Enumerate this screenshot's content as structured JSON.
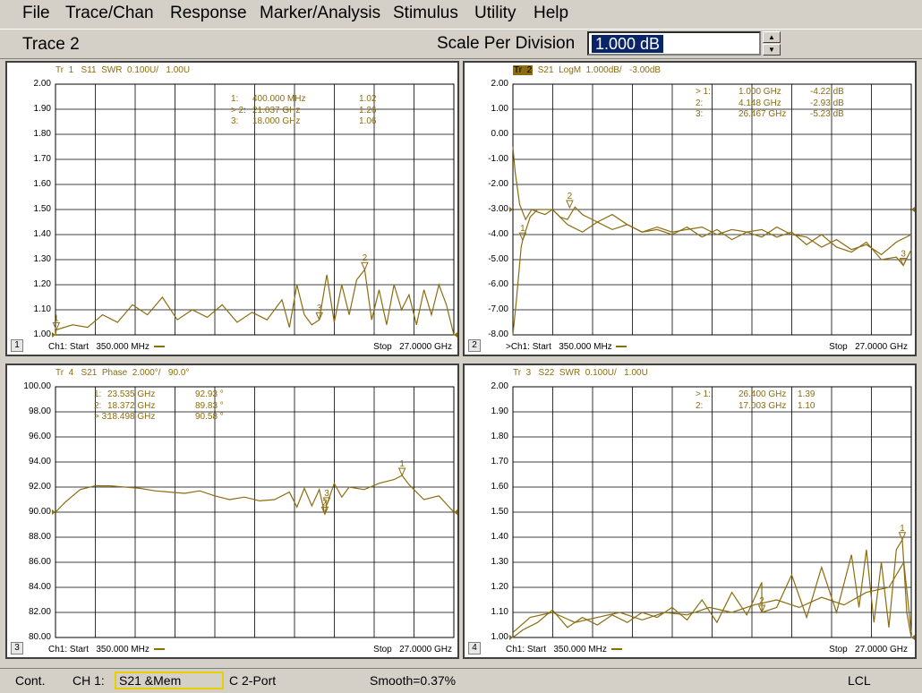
{
  "menu": [
    "File",
    "Trace/Chan",
    "Response",
    "Marker/Analysis",
    "Stimulus",
    "Utility",
    "Help"
  ],
  "toolbar": {
    "active_trace": "Trace 2",
    "scale_label": "Scale Per Division",
    "scale_value": "1.000 dB",
    "spin_up": "▲",
    "spin_down": "▼"
  },
  "colors": {
    "trace": "#8b6c0f",
    "grid": "#000000",
    "bg": "#d4d0c8"
  },
  "panels": [
    {
      "number": "1",
      "trace_info": "Tr  1   S11  SWR  0.100U/   1.00U",
      "start": "Ch1: Start   350.000 MHz ",
      "stop": "Stop   27.0000 GHz",
      "markers": [
        {
          "label": "1:",
          "freq": "400.000 MHz",
          "value": "1.02"
        },
        {
          "label": "> 2:",
          "freq": "21.037 GHz",
          "value": "1.26"
        },
        {
          "label": "3:",
          "freq": "18.000 GHz",
          "value": "1.06"
        }
      ]
    },
    {
      "number": "2",
      "trace_info_hl": "Tr  2",
      "trace_info": "  S21  LogM  1.000dB/   -3.00dB",
      "start": ">Ch1: Start   350.000 MHz ",
      "stop": "Stop   27.0000 GHz",
      "markers": [
        {
          "label": "> 1:",
          "freq": "1.000 GHz",
          "value": "-4.22 dB"
        },
        {
          "label": "2:",
          "freq": "4.148 GHz",
          "value": "-2.93 dB"
        },
        {
          "label": "3:",
          "freq": "26.467 GHz",
          "value": "-5.23 dB"
        }
      ]
    },
    {
      "number": "3",
      "trace_info": "Tr  4   S21  Phase  2.000°/   90.0°",
      "start": "Ch1: Start   350.000 MHz ",
      "stop": "Stop   27.0000 GHz",
      "markers": [
        {
          "label": "1:",
          "freq": "23.535 GHz",
          "value": "92.93 °"
        },
        {
          "label": "2:",
          "freq": "18.372 GHz",
          "value": "89.83 °"
        },
        {
          "label": "> 3:",
          "freq": "18.498 GHz",
          "value": "90.58 °"
        }
      ]
    },
    {
      "number": "4",
      "trace_info": "Tr  3   S22  SWR  0.100U/   1.00U",
      "start": "Ch1: Start   350.000 MHz ",
      "stop": "Stop   27.0000 GHz",
      "markers": [
        {
          "label": "> 1:",
          "freq": "26.400 GHz",
          "value": "1.39"
        },
        {
          "label": "2:",
          "freq": "17.003 GHz",
          "value": "1.10"
        }
      ]
    }
  ],
  "chart_data": [
    {
      "type": "line",
      "title": "Tr 1 S11 SWR 0.100U/ 1.00U",
      "x_unit": "GHz",
      "xlim": [
        0.35,
        27.0
      ],
      "ylim": [
        1.0,
        2.0
      ],
      "yticks": [
        "2.00",
        "1.90",
        "1.80",
        "1.70",
        "1.60",
        "1.50",
        "1.40",
        "1.30",
        "1.20",
        "1.10",
        "1.00"
      ],
      "series": [
        {
          "x": [
            0.35,
            0.4,
            1.5,
            2.5,
            3.5,
            4.5,
            5.5,
            6.5,
            7.5,
            8.5,
            9.5,
            10.5,
            11.5,
            12.5,
            13.5,
            14.5,
            15.5,
            16.0,
            16.5,
            17.0,
            17.5,
            18.0,
            18.5,
            19.0,
            19.5,
            20.0,
            20.5,
            21.037,
            21.5,
            22.0,
            22.5,
            23.0,
            23.5,
            24.0,
            24.5,
            25.0,
            25.5,
            26.0,
            26.5,
            27.0
          ],
          "values": [
            1.0,
            1.02,
            1.04,
            1.03,
            1.08,
            1.05,
            1.12,
            1.08,
            1.15,
            1.06,
            1.1,
            1.07,
            1.12,
            1.05,
            1.09,
            1.06,
            1.14,
            1.03,
            1.2,
            1.08,
            1.04,
            1.06,
            1.24,
            1.05,
            1.2,
            1.08,
            1.22,
            1.26,
            1.06,
            1.18,
            1.04,
            1.2,
            1.1,
            1.16,
            1.04,
            1.18,
            1.08,
            1.2,
            1.12,
            1.0
          ]
        }
      ],
      "markers": [
        {
          "num": "1",
          "x": 0.4,
          "y": 1.02
        },
        {
          "num": "2",
          "x": 21.037,
          "y": 1.26
        },
        {
          "num": "3",
          "x": 18.0,
          "y": 1.06
        }
      ]
    },
    {
      "type": "line",
      "title": "Tr 2 S21 LogM 1.000dB/ -3.00dB",
      "x_unit": "GHz",
      "xlim": [
        0.35,
        27.0
      ],
      "ylim": [
        -8.0,
        2.0
      ],
      "yticks": [
        "2.00",
        "1.00",
        "0.00",
        "-1.00",
        "-2.00",
        "-3.00",
        "-4.00",
        "-5.00",
        "-6.00",
        "-7.00",
        "-8.00"
      ],
      "series": [
        {
          "name": "data",
          "x": [
            0.35,
            0.5,
            0.8,
            1.2,
            1.6,
            2.0,
            2.5,
            3.0,
            3.5,
            4.0,
            4.5,
            5.0,
            6.0,
            7.0,
            8.0,
            9.0,
            10.0,
            11.0,
            12.0,
            13.0,
            14.0,
            15.0,
            16.0,
            17.0,
            18.0,
            19.0,
            20.0,
            21.0,
            22.0,
            23.0,
            24.0,
            25.0,
            26.0,
            26.467,
            27.0
          ],
          "values": [
            -0.5,
            -1.5,
            -2.8,
            -3.4,
            -3.0,
            -3.1,
            -3.2,
            -3.0,
            -3.3,
            -3.4,
            -2.9,
            -3.2,
            -3.5,
            -3.2,
            -3.6,
            -3.9,
            -3.8,
            -4.0,
            -3.7,
            -4.1,
            -3.8,
            -4.2,
            -3.9,
            -3.8,
            -4.1,
            -3.9,
            -4.4,
            -4.0,
            -4.5,
            -4.7,
            -4.3,
            -5.0,
            -4.9,
            -5.23,
            -4.6
          ]
        },
        {
          "name": "memory",
          "x": [
            0.35,
            0.6,
            0.9,
            1.0,
            1.5,
            2.0,
            3.0,
            4.0,
            5.0,
            6.0,
            7.0,
            8.0,
            9.0,
            10.0,
            11.0,
            12.0,
            13.0,
            14.0,
            15.0,
            16.0,
            17.0,
            18.0,
            19.0,
            20.0,
            21.0,
            22.0,
            23.0,
            24.0,
            25.0,
            26.0,
            27.0
          ],
          "values": [
            -8.0,
            -6.5,
            -4.5,
            -4.22,
            -3.3,
            -3.0,
            -3.0,
            -3.6,
            -3.9,
            -3.5,
            -3.8,
            -3.6,
            -3.9,
            -3.7,
            -3.9,
            -3.8,
            -3.7,
            -4.0,
            -3.8,
            -3.9,
            -4.1,
            -3.7,
            -4.0,
            -4.1,
            -4.5,
            -4.2,
            -4.6,
            -4.4,
            -4.8,
            -4.3,
            -4.0
          ]
        }
      ],
      "markers": [
        {
          "num": "1",
          "x": 1.0,
          "y": -4.22
        },
        {
          "num": "2",
          "x": 4.148,
          "y": -2.93
        },
        {
          "num": "3",
          "x": 26.467,
          "y": -5.23
        }
      ]
    },
    {
      "type": "line",
      "title": "Tr 4 S21 Phase 2.000°/ 90.0°",
      "x_unit": "GHz",
      "xlim": [
        0.35,
        27.0
      ],
      "ylim": [
        80.0,
        100.0
      ],
      "yticks": [
        "100.00",
        "98.00",
        "96.00",
        "94.00",
        "92.00",
        "90.00",
        "88.00",
        "86.00",
        "84.00",
        "82.00",
        "80.00"
      ],
      "series": [
        {
          "x": [
            0.35,
            1.0,
            2.0,
            3.0,
            4.0,
            5.0,
            6.0,
            7.0,
            8.0,
            9.0,
            10.0,
            11.0,
            12.0,
            13.0,
            14.0,
            15.0,
            16.0,
            16.5,
            17.0,
            17.5,
            18.0,
            18.372,
            18.498,
            19.0,
            19.5,
            20.0,
            21.0,
            22.0,
            23.0,
            23.535,
            24.0,
            25.0,
            26.0,
            27.0
          ],
          "values": [
            90.0,
            90.8,
            91.8,
            92.1,
            92.1,
            92.0,
            91.9,
            91.7,
            91.6,
            91.5,
            91.7,
            91.3,
            91.0,
            91.2,
            90.9,
            91.0,
            91.6,
            90.4,
            91.9,
            90.5,
            91.8,
            89.83,
            90.58,
            92.3,
            91.2,
            92.0,
            91.8,
            92.3,
            92.6,
            92.93,
            92.2,
            91.0,
            91.3,
            90.0
          ]
        }
      ],
      "markers": [
        {
          "num": "1",
          "x": 23.535,
          "y": 92.93
        },
        {
          "num": "2",
          "x": 18.372,
          "y": 89.83
        },
        {
          "num": "3",
          "x": 18.498,
          "y": 90.58
        }
      ]
    },
    {
      "type": "line",
      "title": "Tr 3 S22 SWR 0.100U/ 1.00U",
      "x_unit": "GHz",
      "xlim": [
        0.35,
        27.0
      ],
      "ylim": [
        1.0,
        2.0
      ],
      "yticks": [
        "2.00",
        "1.90",
        "1.80",
        "1.70",
        "1.60",
        "1.50",
        "1.40",
        "1.30",
        "1.20",
        "1.10",
        "1.00"
      ],
      "series": [
        {
          "name": "data",
          "x": [
            0.35,
            1.0,
            2.0,
            3.0,
            4.0,
            5.0,
            6.0,
            7.0,
            8.0,
            9.0,
            10.0,
            11.0,
            12.0,
            13.0,
            14.0,
            15.0,
            16.0,
            17.0,
            17.003,
            18.0,
            19.0,
            20.0,
            21.0,
            22.0,
            23.0,
            23.5,
            24.0,
            24.5,
            25.0,
            25.5,
            26.0,
            26.4,
            26.7,
            27.0
          ],
          "values": [
            1.0,
            1.03,
            1.06,
            1.11,
            1.04,
            1.08,
            1.05,
            1.09,
            1.06,
            1.1,
            1.08,
            1.12,
            1.07,
            1.15,
            1.06,
            1.18,
            1.09,
            1.22,
            1.1,
            1.12,
            1.25,
            1.08,
            1.28,
            1.1,
            1.33,
            1.12,
            1.35,
            1.06,
            1.3,
            1.04,
            1.35,
            1.39,
            1.1,
            1.0
          ]
        },
        {
          "name": "memory",
          "x": [
            0.35,
            1.5,
            3.0,
            4.5,
            6.0,
            7.5,
            9.0,
            10.5,
            12.0,
            13.5,
            15.0,
            16.5,
            18.0,
            19.5,
            21.0,
            22.5,
            24.0,
            25.5,
            26.5,
            27.0
          ],
          "values": [
            1.02,
            1.08,
            1.1,
            1.06,
            1.08,
            1.1,
            1.07,
            1.1,
            1.09,
            1.12,
            1.1,
            1.13,
            1.15,
            1.12,
            1.16,
            1.13,
            1.18,
            1.2,
            1.3,
            1.02
          ]
        }
      ],
      "markers": [
        {
          "num": "1",
          "x": 26.4,
          "y": 1.39
        },
        {
          "num": "2",
          "x": 17.003,
          "y": 1.1
        }
      ]
    }
  ],
  "status": {
    "mode": "Cont.",
    "channel": "CH 1:",
    "measurement": "S21 &Mem",
    "cal": "C  2-Port",
    "smooth": "Smooth=0.37%",
    "remote": "LCL"
  }
}
